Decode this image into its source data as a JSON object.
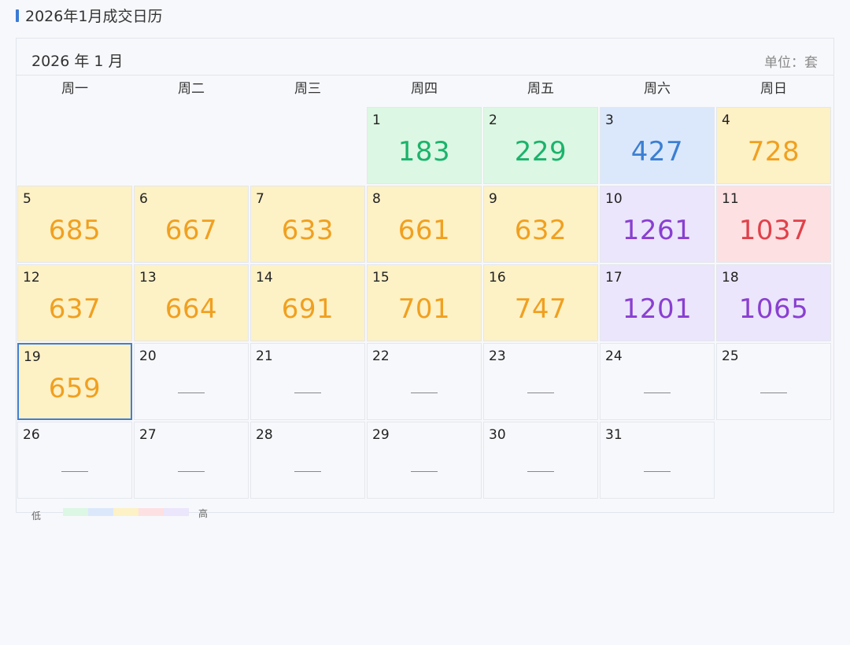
{
  "title": "2026年1月成交日历",
  "header": {
    "month": "2026 年 1 月",
    "unit": "单位：套"
  },
  "weekdays": [
    "周一",
    "周二",
    "周三",
    "周四",
    "周五",
    "周六",
    "周日"
  ],
  "leading_blanks": 3,
  "trailing_blanks": 1,
  "days": [
    {
      "day": "1",
      "value": "183",
      "tier": "green"
    },
    {
      "day": "2",
      "value": "229",
      "tier": "green"
    },
    {
      "day": "3",
      "value": "427",
      "tier": "blue"
    },
    {
      "day": "4",
      "value": "728",
      "tier": "yellow"
    },
    {
      "day": "5",
      "value": "685",
      "tier": "yellow"
    },
    {
      "day": "6",
      "value": "667",
      "tier": "yellow"
    },
    {
      "day": "7",
      "value": "633",
      "tier": "yellow"
    },
    {
      "day": "8",
      "value": "661",
      "tier": "yellow"
    },
    {
      "day": "9",
      "value": "632",
      "tier": "yellow"
    },
    {
      "day": "10",
      "value": "1261",
      "tier": "purple"
    },
    {
      "day": "11",
      "value": "1037",
      "tier": "red"
    },
    {
      "day": "12",
      "value": "637",
      "tier": "yellow"
    },
    {
      "day": "13",
      "value": "664",
      "tier": "yellow"
    },
    {
      "day": "14",
      "value": "691",
      "tier": "yellow"
    },
    {
      "day": "15",
      "value": "701",
      "tier": "yellow"
    },
    {
      "day": "16",
      "value": "747",
      "tier": "yellow"
    },
    {
      "day": "17",
      "value": "1201",
      "tier": "purple"
    },
    {
      "day": "18",
      "value": "1065",
      "tier": "purple"
    },
    {
      "day": "19",
      "value": "659",
      "tier": "yellow",
      "selected": true
    },
    {
      "day": "20",
      "value": "—",
      "tier": "none"
    },
    {
      "day": "21",
      "value": "—",
      "tier": "none"
    },
    {
      "day": "22",
      "value": "—",
      "tier": "none"
    },
    {
      "day": "23",
      "value": "—",
      "tier": "none"
    },
    {
      "day": "24",
      "value": "—",
      "tier": "none"
    },
    {
      "day": "25",
      "value": "—",
      "tier": "none"
    },
    {
      "day": "26",
      "value": "—",
      "tier": "none"
    },
    {
      "day": "27",
      "value": "—",
      "tier": "none"
    },
    {
      "day": "28",
      "value": "—",
      "tier": "none"
    },
    {
      "day": "29",
      "value": "—",
      "tier": "none"
    },
    {
      "day": "30",
      "value": "—",
      "tier": "none"
    },
    {
      "day": "31",
      "value": "—",
      "tier": "none"
    }
  ],
  "tiers": {
    "green": {
      "bg": "#dcf7e3",
      "fg": "#1bb36b"
    },
    "blue": {
      "bg": "#dbe8fb",
      "fg": "#3b7fd3"
    },
    "yellow": {
      "bg": "#fdf1c6",
      "fg": "#f0a020"
    },
    "red": {
      "bg": "#fde0e2",
      "fg": "#e0414a"
    },
    "purple": {
      "bg": "#ebe6fb",
      "fg": "#8a3fd1"
    },
    "none": {
      "bg": "#f7f8fb",
      "fg": "#888888"
    }
  },
  "legend": {
    "low": "低",
    "high": "高",
    "colors": [
      "#dcf7e3",
      "#dbe8fb",
      "#fdf1c6",
      "#fde0e2",
      "#ebe6fb"
    ]
  }
}
